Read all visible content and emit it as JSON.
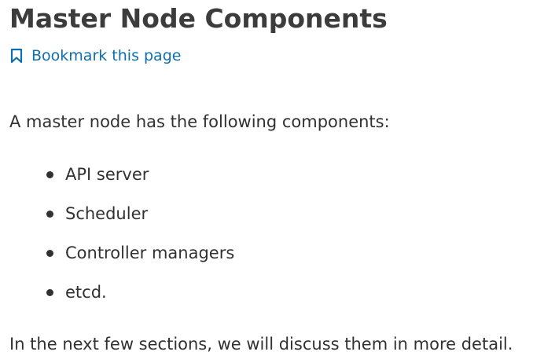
{
  "header": {
    "title": "Master Node Components",
    "bookmark_label": "Bookmark this page",
    "bookmark_icon": "bookmark-icon"
  },
  "content": {
    "intro": "A master node has the following components:",
    "components": [
      "API server",
      "Scheduler",
      "Controller managers",
      "etcd."
    ],
    "outro": "In the next few sections, we will discuss them in more detail."
  },
  "colors": {
    "text": "#313131",
    "title": "#3c3c3c",
    "link": "#0f6fae"
  }
}
